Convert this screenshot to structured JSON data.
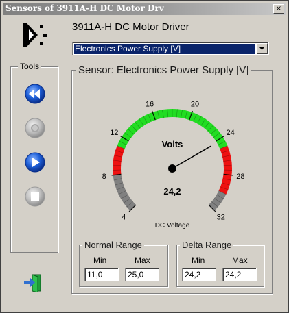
{
  "window": {
    "title": "Sensors of 3911A-H DC Motor Drv",
    "close_glyph": "×"
  },
  "app": {
    "title": "3911A-H DC Motor Driver",
    "logo_icon": "device-logo-icon"
  },
  "sensor_select": {
    "value": "Electronics Power Supply [V]"
  },
  "tools": {
    "label": "Tools",
    "buttons": [
      {
        "name": "rewind-button",
        "icon": "rewind-icon",
        "enabled": true
      },
      {
        "name": "pause-button",
        "icon": "pause-icon",
        "enabled": false
      },
      {
        "name": "play-button",
        "icon": "play-icon",
        "enabled": true
      },
      {
        "name": "stop-button",
        "icon": "stop-icon",
        "enabled": false
      }
    ],
    "exit_icon": "exit-door-icon"
  },
  "sensor": {
    "group_label": "Sensor: Electronics Power Supply [V]",
    "gauge": {
      "unit_label": "Volts",
      "value_text": "24,2",
      "caption": "DC Voltage",
      "min": 4,
      "max": 32,
      "value": 24.2,
      "ticks": [
        4,
        8,
        12,
        16,
        20,
        24,
        28,
        32
      ],
      "zones": [
        {
          "from": 4,
          "to": 8,
          "color": "#808080"
        },
        {
          "from": 8,
          "to": 11,
          "color": "#ee1111"
        },
        {
          "from": 11,
          "to": 25,
          "color": "#22dd22"
        },
        {
          "from": 25,
          "to": 30,
          "color": "#ee1111"
        },
        {
          "from": 30,
          "to": 32,
          "color": "#808080"
        }
      ]
    },
    "normal_range": {
      "label": "Normal Range",
      "min_label": "Min",
      "max_label": "Max",
      "min_value": "11,0",
      "max_value": "25,0"
    },
    "delta_range": {
      "label": "Delta Range",
      "min_label": "Min",
      "max_label": "Max",
      "min_value": "24,2",
      "max_value": "24,2"
    }
  }
}
